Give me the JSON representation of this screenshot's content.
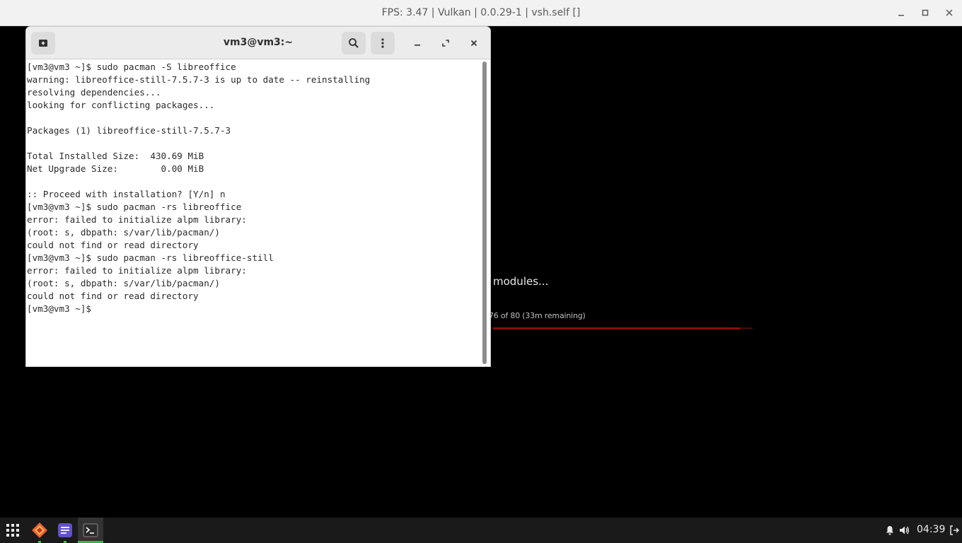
{
  "emulator": {
    "title": "FPS: 3.47 | Vulkan | 0.0.29-1 | vsh.self []",
    "controls": [
      "minimize",
      "maximize",
      "close"
    ],
    "loading_text": "modules...",
    "progress_text": "76 of 80 (33m remaining)",
    "progress_value": 0.95
  },
  "terminal": {
    "title": "vm3@vm3:~",
    "lines": [
      "[vm3@vm3 ~]$ sudo pacman -S libreoffice",
      "warning: libreoffice-still-7.5.7-3 is up to date -- reinstalling",
      "resolving dependencies...",
      "looking for conflicting packages...",
      "",
      "Packages (1) libreoffice-still-7.5.7-3",
      "",
      "Total Installed Size:  430.69 MiB",
      "Net Upgrade Size:        0.00 MiB",
      "",
      ":: Proceed with installation? [Y/n] n",
      "[vm3@vm3 ~]$ sudo pacman -rs libreoffice",
      "error: failed to initialize alpm library:",
      "(root: s, dbpath: s/var/lib/pacman/)",
      "could not find or read directory",
      "[vm3@vm3 ~]$ sudo pacman -rs libreoffice-still",
      "error: failed to initialize alpm library:",
      "(root: s, dbpath: s/var/lib/pacman/)",
      "could not find or read directory",
      "[vm3@vm3 ~]$ "
    ]
  },
  "taskbar": {
    "apps": [
      "app-grid-icon",
      "rpcs3-icon",
      "text-editor-icon",
      "terminal-icon"
    ],
    "active_app": "terminal-icon",
    "clock": "04:39",
    "colors": {
      "accent": "#3fb24e",
      "progress": "#8c0c0c"
    }
  }
}
